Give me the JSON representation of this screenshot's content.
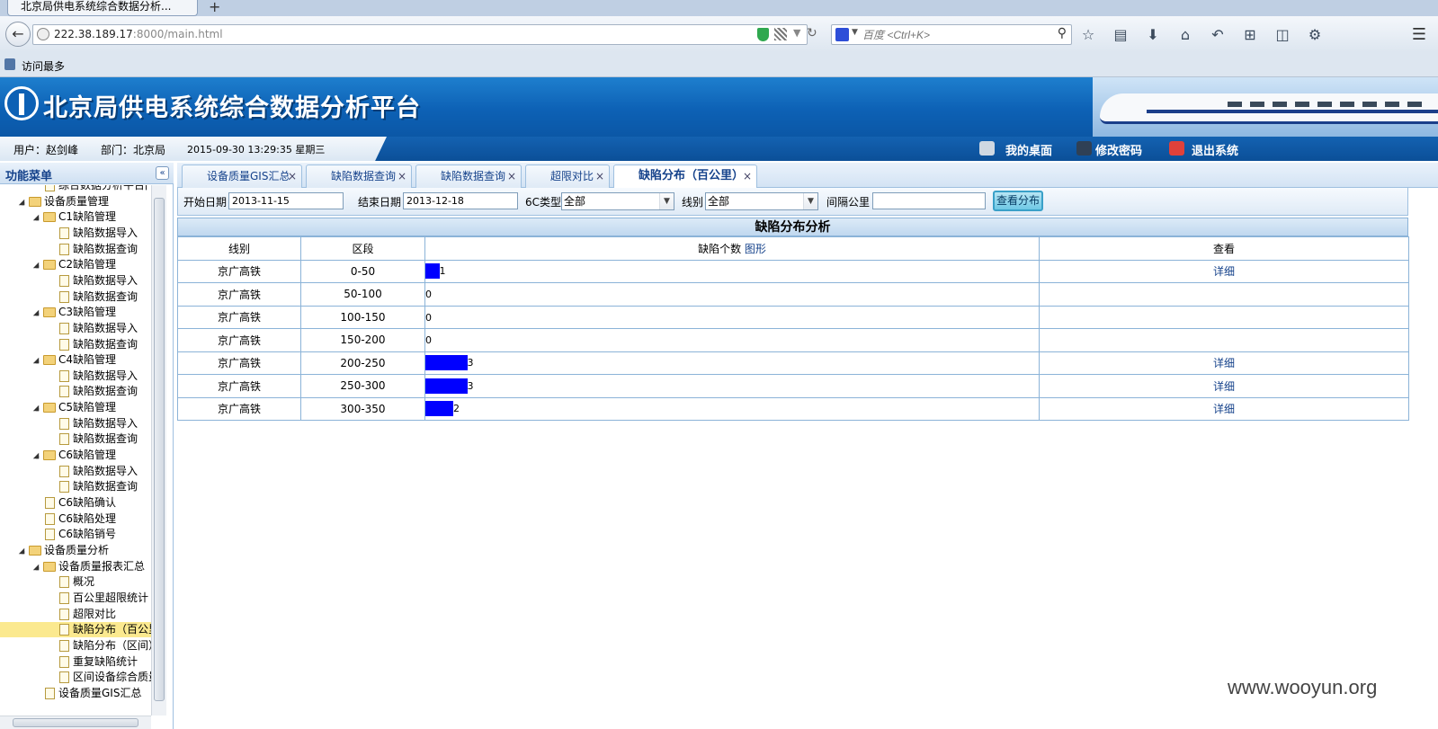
{
  "browser": {
    "tab_title": "北京局供电系统综合数据分析...",
    "url_host": "222.38.189.17",
    "url_rest": ":8000/main.html",
    "search_placeholder": "百度 <Ctrl+K>",
    "bookmark": "访问最多"
  },
  "app": {
    "title": "北京局供电系统综合数据分析平台",
    "user": "用户：赵剑峰",
    "dept": "部门：北京局",
    "datetime": "2015-09-30 13:29:35 星期三",
    "nav": {
      "desktop": "我的桌面",
      "password": "修改密码",
      "logout": "退出系统"
    }
  },
  "sidebar": {
    "title": "功能菜单",
    "items": [
      {
        "label": "综合数据分析平台门户",
        "type": "doc",
        "level": 2,
        "top": 0
      },
      {
        "label": "设备质量管理",
        "type": "folder",
        "level": 1
      },
      {
        "label": "C1缺陷管理",
        "type": "folder",
        "level": 2
      },
      {
        "label": "缺陷数据导入",
        "type": "doc",
        "level": 3
      },
      {
        "label": "缺陷数据查询",
        "type": "doc",
        "level": 3
      },
      {
        "label": "C2缺陷管理",
        "type": "folder",
        "level": 2
      },
      {
        "label": "缺陷数据导入",
        "type": "doc",
        "level": 3
      },
      {
        "label": "缺陷数据查询",
        "type": "doc",
        "level": 3
      },
      {
        "label": "C3缺陷管理",
        "type": "folder",
        "level": 2
      },
      {
        "label": "缺陷数据导入",
        "type": "doc",
        "level": 3
      },
      {
        "label": "缺陷数据查询",
        "type": "doc",
        "level": 3
      },
      {
        "label": "C4缺陷管理",
        "type": "folder",
        "level": 2
      },
      {
        "label": "缺陷数据导入",
        "type": "doc",
        "level": 3
      },
      {
        "label": "缺陷数据查询",
        "type": "doc",
        "level": 3
      },
      {
        "label": "C5缺陷管理",
        "type": "folder",
        "level": 2
      },
      {
        "label": "缺陷数据导入",
        "type": "doc",
        "level": 3
      },
      {
        "label": "缺陷数据查询",
        "type": "doc",
        "level": 3
      },
      {
        "label": "C6缺陷管理",
        "type": "folder",
        "level": 2
      },
      {
        "label": "缺陷数据导入",
        "type": "doc",
        "level": 3
      },
      {
        "label": "缺陷数据查询",
        "type": "doc",
        "level": 3
      },
      {
        "label": "C6缺陷确认",
        "type": "doc",
        "level": 2
      },
      {
        "label": "C6缺陷处理",
        "type": "doc",
        "level": 2
      },
      {
        "label": "C6缺陷销号",
        "type": "doc",
        "level": 2
      },
      {
        "label": "设备质量分析",
        "type": "folder",
        "level": 1
      },
      {
        "label": "设备质量报表汇总",
        "type": "folder",
        "level": 2
      },
      {
        "label": "概况",
        "type": "doc",
        "level": 3
      },
      {
        "label": "百公里超限统计",
        "type": "doc",
        "level": 3
      },
      {
        "label": "超限对比",
        "type": "doc",
        "level": 3
      },
      {
        "label": "缺陷分布（百公里）",
        "type": "doc",
        "level": 3,
        "selected": true
      },
      {
        "label": "缺陷分布（区间）",
        "type": "doc",
        "level": 3
      },
      {
        "label": "重复缺陷统计",
        "type": "doc",
        "level": 3
      },
      {
        "label": "区间设备综合质量",
        "type": "doc",
        "level": 3
      },
      {
        "label": "设备质量GIS汇总",
        "type": "doc",
        "level": 2
      }
    ]
  },
  "tabs": [
    {
      "label": "设备质量GIS汇总"
    },
    {
      "label": "缺陷数据查询"
    },
    {
      "label": "缺陷数据查询"
    },
    {
      "label": "超限对比"
    },
    {
      "label": "缺陷分布（百公里）",
      "active": true
    }
  ],
  "filters": {
    "start_label": "开始日期",
    "start_value": "2013-11-15",
    "end_label": "结束日期",
    "end_value": "2013-12-18",
    "type_label": "6C类型",
    "type_value": "全部",
    "line_label": "线别",
    "line_value": "全部",
    "interval_label": "间隔公里",
    "interval_value": "",
    "query_button": "查看分布"
  },
  "result": {
    "title": "缺陷分布分析",
    "headers": [
      "线别",
      "区段",
      "缺陷个数",
      "图形",
      "查看"
    ],
    "rows": [
      {
        "line": "京广高铁",
        "section": "0-50",
        "count": 1,
        "view": "详细"
      },
      {
        "line": "京广高铁",
        "section": "50-100",
        "count": 0,
        "view": ""
      },
      {
        "line": "京广高铁",
        "section": "100-150",
        "count": 0,
        "view": ""
      },
      {
        "line": "京广高铁",
        "section": "150-200",
        "count": 0,
        "view": ""
      },
      {
        "line": "京广高铁",
        "section": "200-250",
        "count": 3,
        "view": "详细"
      },
      {
        "line": "京广高铁",
        "section": "250-300",
        "count": 3,
        "view": "详细"
      },
      {
        "line": "京广高铁",
        "section": "300-350",
        "count": 2,
        "view": "详细"
      }
    ],
    "bar_color": "#0000ff"
  },
  "watermark": "www.wooyun.org"
}
